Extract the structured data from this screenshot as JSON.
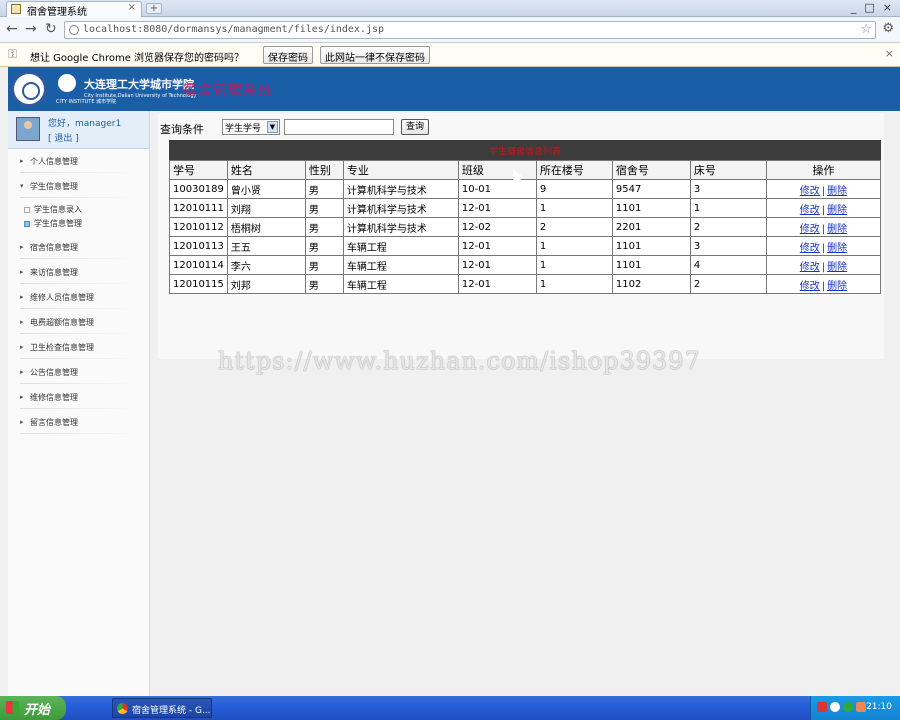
{
  "browser": {
    "tab_title": "宿舍管理系统",
    "tab_close": "×",
    "new_tab": "+",
    "window_buttons": [
      "_",
      "□",
      "×"
    ],
    "url": "localhost:8080/dormansys/managment/files/index.jsp",
    "infobar": {
      "message": "想让 Google Chrome 浏览器保存您的密码吗？",
      "save_button": "保存密码",
      "never_button": "此网站一律不保存密码",
      "close": "×"
    }
  },
  "banner": {
    "school_name": "大连理工大学城市学院",
    "school_en": "City Institute,Dalian University of Technology",
    "school_sub": "CITY INSTITUTE 城市学院",
    "system_title": "宿舍管理系统"
  },
  "user": {
    "greeting": "您好，manager1",
    "logout": "[ 退出 ]"
  },
  "menu": [
    {
      "label": "个人信息管理",
      "arrow": "▸"
    },
    {
      "label": "学生信息管理",
      "arrow": "▾"
    },
    {
      "label": "宿舍信息管理",
      "arrow": "▸"
    },
    {
      "label": "来访信息管理",
      "arrow": "▸"
    },
    {
      "label": "维修人员信息管理",
      "arrow": "▸"
    },
    {
      "label": "电费超额信息管理",
      "arrow": "▸"
    },
    {
      "label": "卫生检查信息管理",
      "arrow": "▸"
    },
    {
      "label": "公告信息管理",
      "arrow": "▸"
    },
    {
      "label": "维修信息管理",
      "arrow": "▸"
    },
    {
      "label": "留言信息管理",
      "arrow": "▸"
    }
  ],
  "submenu": [
    {
      "label": "学生信息录入"
    },
    {
      "label": "学生信息管理"
    }
  ],
  "query": {
    "label": "查询条件",
    "select_value": "学生学号",
    "input_value": "",
    "button": "查询"
  },
  "table": {
    "caption": "学生宿舍信息列表",
    "headers": [
      "学号",
      "姓名",
      "性别",
      "专业",
      "班级",
      "所在楼号",
      "宿舍号",
      "床号",
      "操作"
    ],
    "edit_label": "修改",
    "delete_label": "删除",
    "rows": [
      [
        "10030189",
        "曾小贤",
        "男",
        "计算机科学与技术",
        "10-01",
        "9",
        "9547",
        "3"
      ],
      [
        "12010111",
        "刘翔",
        "男",
        "计算机科学与技术",
        "12-01",
        "1",
        "1101",
        "1"
      ],
      [
        "12010112",
        "梧桐树",
        "男",
        "计算机科学与技术",
        "12-02",
        "2",
        "2201",
        "2"
      ],
      [
        "12010113",
        "王五",
        "男",
        "车辆工程",
        "12-01",
        "1",
        "1101",
        "3"
      ],
      [
        "12010114",
        "李六",
        "男",
        "车辆工程",
        "12-01",
        "1",
        "1101",
        "4"
      ],
      [
        "12010115",
        "刘邦",
        "男",
        "车辆工程",
        "12-01",
        "1",
        "1102",
        "2"
      ]
    ]
  },
  "watermark": "https://www.huzhan.com/ishop39397",
  "taskbar": {
    "start": "开始",
    "task_label": "宿舍管理系统 - G...",
    "clock": "21:10"
  }
}
